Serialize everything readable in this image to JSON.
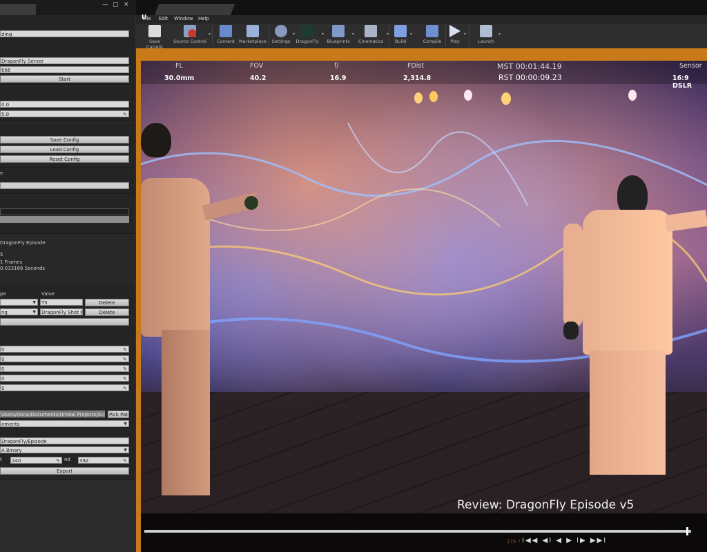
{
  "left_panel": {
    "window_controls": [
      "—",
      "▢",
      "✕"
    ],
    "recording_field": "ding",
    "server_field": "DragonFly Server",
    "port_field": "666",
    "start_label": "Start",
    "field_a": "0.0",
    "field_b": "5.0",
    "save_config": "Save Config",
    "load_config": "Load Config",
    "reset_config": "Reset Config",
    "section_label": "e",
    "episode_lines": [
      "DragonFly Episode",
      "5",
      "1 Frames",
      "0.033166 Seconds"
    ],
    "table_headers": [
      "pe",
      "Value"
    ],
    "table_rows": [
      {
        "type": "",
        "value": "T5",
        "action": "Delete"
      },
      {
        "type": "ng",
        "value": "DragonFly Shot 6",
        "action": "Delete"
      }
    ],
    "rows5": [
      "0",
      "0",
      "0",
      "0",
      "0"
    ],
    "path_field": "Users/Anna/Documents/Unreal Projects/Scenes",
    "pick_path": "Pick Pat",
    "exports_dropdown": "ements",
    "episode_path": "DragonFly/Episode",
    "format_dropdown": "A Binary",
    "start_label2": "t",
    "start_value": "240",
    "end_label": "nd",
    "end_value": "392",
    "export_label": "Export"
  },
  "menubar": [
    "File",
    "Edit",
    "Window",
    "Help"
  ],
  "toolbar": [
    {
      "label": "Save Current",
      "icon": "save-icon",
      "color": "#dcdcdc"
    },
    {
      "label": "Source Control",
      "icon": "source-control-icon",
      "color": "#c23a2a"
    },
    {
      "label": "Content",
      "icon": "content-icon",
      "color": "#6a8ad0"
    },
    {
      "label": "Marketplace",
      "icon": "marketplace-icon",
      "color": "#9ab0d8"
    },
    {
      "label": "Settings",
      "icon": "settings-icon",
      "color": "#8899bb"
    },
    {
      "label": "DragonFly",
      "icon": "dragonfly-icon",
      "color": "#3a6a5a"
    },
    {
      "label": "Blueprints",
      "icon": "blueprints-icon",
      "color": "#7f9ac8"
    },
    {
      "label": "Cinematics",
      "icon": "cinematics-icon",
      "color": "#aab4c8"
    },
    {
      "label": "Build",
      "icon": "build-icon",
      "color": "#7fa0e0"
    },
    {
      "label": "Compile",
      "icon": "compile-icon",
      "color": "#6f8fd0"
    },
    {
      "label": "Play",
      "icon": "play-icon",
      "color": "#d8e0f0"
    },
    {
      "label": "Launch",
      "icon": "launch-icon",
      "color": "#b0bcd0"
    }
  ],
  "hud": {
    "labels": [
      "FL",
      "FOV",
      "f/",
      "FDist",
      "MST 00:01:44.19",
      "Sensor"
    ],
    "values": [
      "30.0mm",
      "40.2",
      "16.9",
      "2,314.8",
      "RST 00:00:09.23",
      "16:9 DSLR"
    ]
  },
  "caption": "Review: DragonFly Episode v5",
  "frame_counter": "176.7",
  "transport": "I◀◀ ◀I ◀ ▶ I▶ ▶▶I"
}
